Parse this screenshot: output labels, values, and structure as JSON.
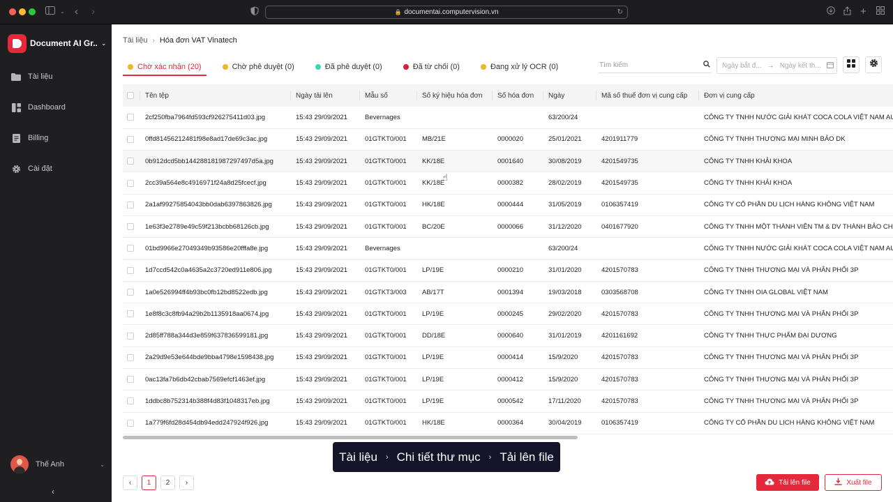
{
  "browser": {
    "url": "documentai.computervision.vn"
  },
  "sidebar": {
    "brand": "Document AI Gr...",
    "items": [
      {
        "label": "Tài liệu",
        "icon": "folder-icon"
      },
      {
        "label": "Dashboard",
        "icon": "dashboard-icon"
      },
      {
        "label": "Billing",
        "icon": "billing-icon"
      },
      {
        "label": "Cài đặt",
        "icon": "gear-icon"
      }
    ],
    "user": "Thế Anh"
  },
  "breadcrumb": [
    "Tài liệu",
    "Hóa đơn VAT Vinatech"
  ],
  "tabs": [
    {
      "label": "Chờ xác nhận (20)",
      "color": "#f0b429",
      "active": true
    },
    {
      "label": "Chờ phê duyệt (0)",
      "color": "#f0b429"
    },
    {
      "label": "Đã phê duyệt (0)",
      "color": "#3bd5b0"
    },
    {
      "label": "Đã từ chối (0)",
      "color": "#d61f3b"
    },
    {
      "label": "Đang xử lý OCR (0)",
      "color": "#f0b429"
    }
  ],
  "search": {
    "placeholder": "Tìm kiếm"
  },
  "daterange": {
    "start": "Ngày bắt đ...",
    "end": "Ngày kết th..."
  },
  "table": {
    "columns": [
      "Tên tệp",
      "Ngày tải lên",
      "Mẫu số",
      "Số ký hiệu hóa đơn",
      "Số hóa đơn",
      "Ngày",
      "Mã số thuế đơn vị cung cấp",
      "Đơn vị cung cấp"
    ],
    "rows": [
      [
        "2cf250fba7964fd593cf926275411d03.jpg",
        "15:43 29/09/2021",
        "Bevernages",
        "",
        "",
        "63/200/24",
        "",
        "CÔNG TY TNHH NƯỚC GIẢI KHÁT COCA COLA VIỆT NAM AUL CO"
      ],
      [
        "0ffd81456212481f98e8ad17de69c3ac.jpg",
        "15:43 29/09/2021",
        "01GTKT0/001",
        "MB/21E",
        "0000020",
        "25/01/2021",
        "4201911779",
        "CÔNG TY TNHH THƯƠNG MẠI MINH BẢO DK"
      ],
      [
        "0b912dcd5bb144288181987297497d5a.jpg",
        "15:43 29/09/2021",
        "01GTKT0/001",
        "KK/18E",
        "0001640",
        "30/08/2019",
        "4201549735",
        "CÔNG TY TNHH KHẢI KHOA"
      ],
      [
        "2cc39a564e8c4916971f24a8d25fcecf.jpg",
        "15:43 29/09/2021",
        "01GTKT0/001",
        "KK/18E",
        "0000382",
        "28/02/2019",
        "4201549735",
        "CÔNG TY TNHH KHẢI KHOA"
      ],
      [
        "2a1af99275854043bb0dab6397863826.jpg",
        "15:43 29/09/2021",
        "01GTKT0/001",
        "HK/18E",
        "0000444",
        "31/05/2019",
        "0106357419",
        "CÔNG TY CỔ PHẦN DU LỊCH HÀNG KHÔNG VIỆT NAM"
      ],
      [
        "1e63f3e2789e49c59f213bcbb68126cb.jpg",
        "15:43 29/09/2021",
        "01GTKT0/001",
        "BC/20E",
        "0000066",
        "31/12/2020",
        "0401677920",
        "CÔNG TY TNHH MỘT THÀNH VIÊN TM & DV THÀNH BẢO CHÂU"
      ],
      [
        "01bd9966e27049349b93586e20fffa8e.jpg",
        "15:43 29/09/2021",
        "Bevernages",
        "",
        "",
        "63/200/24",
        "",
        "CÔNG TY TNHH NƯỚC GIẢI KHÁT COCA COLA VIỆT NAM AUL CO"
      ],
      [
        "1d7ccd542c0a4635a2c3720ed911e806.jpg",
        "15:43 29/09/2021",
        "01GTKT0/001",
        "LP/19E",
        "0000210",
        "31/01/2020",
        "4201570783",
        "CÔNG TY TNHH THƯƠNG MẠI VÀ PHÂN PHỐI 3P"
      ],
      [
        "1a0e526994ff4b93bc0fb12bd8522edb.jpg",
        "15:43 29/09/2021",
        "01GTKT3/003",
        "AB/17T",
        "0001394",
        "19/03/2018",
        "0303568708",
        "CÔNG TY TNHH OIA GLOBAL VIỆT NAM"
      ],
      [
        "1e8f8c3c8fb94a29b2b1135918aa0674.jpg",
        "15:43 29/09/2021",
        "01GTKT0/001",
        "LP/19E",
        "0000245",
        "29/02/2020",
        "4201570783",
        "CÔNG TY TNHH THƯƠNG MẠI VÀ PHÂN PHỐI 3P"
      ],
      [
        "2d85ff788a344d3e859f637836599181.jpg",
        "15:43 29/09/2021",
        "01GTKT0/001",
        "DD/18E",
        "0000640",
        "31/01/2019",
        "4201161692",
        "CÔNG TY TNHH THỰC PHẨM ĐẠI DƯƠNG"
      ],
      [
        "2a29d9e53e644bde9bba4798e1598438.jpg",
        "15:43 29/09/2021",
        "01GTKT0/001",
        "LP/19E",
        "0000414",
        "15/9/2020",
        "4201570783",
        "CÔNG TY TNHH THƯƠNG MẠI VÀ PHÂN PHỐI 3P"
      ],
      [
        "0ac13fa7b6db42cbab7569efcf1463ef.jpg",
        "15:43 29/09/2021",
        "01GTKT0/001",
        "LP/19E",
        "0000412",
        "15/9/2020",
        "4201570783",
        "CÔNG TY TNHH THƯƠNG MẠI VÀ PHÂN PHỐI 3P"
      ],
      [
        "1ddbc8b752314b388f4d83f1048317eb.jpg",
        "15:43 29/09/2021",
        "01GTKT0/001",
        "LP/19E",
        "0000542",
        "17/11/2020",
        "4201570783",
        "CÔNG TY TNHH THƯƠNG MẠI VÀ PHÂN PHỐI 3P"
      ],
      [
        "1a779f6fd28d454db94edd247924f926.jpg",
        "15:43 29/09/2021",
        "01GTKT0/001",
        "HK/18E",
        "0000364",
        "30/04/2019",
        "0106357419",
        "CÔNG TY CỔ PHẦN DU LỊCH HÀNG KHÔNG VIỆT NAM"
      ]
    ]
  },
  "pagination": {
    "pages": [
      "1",
      "2"
    ],
    "prev": "‹",
    "next": "›"
  },
  "actions": {
    "upload": "Tải lên file",
    "export": "Xuất file"
  },
  "caption": {
    "parts": [
      "Tài liệu",
      "Chi tiết thư mục",
      "Tải lên file"
    ]
  },
  "colors": {
    "accent": "#e5283a",
    "sidebar_bg": "#1f1f22"
  }
}
